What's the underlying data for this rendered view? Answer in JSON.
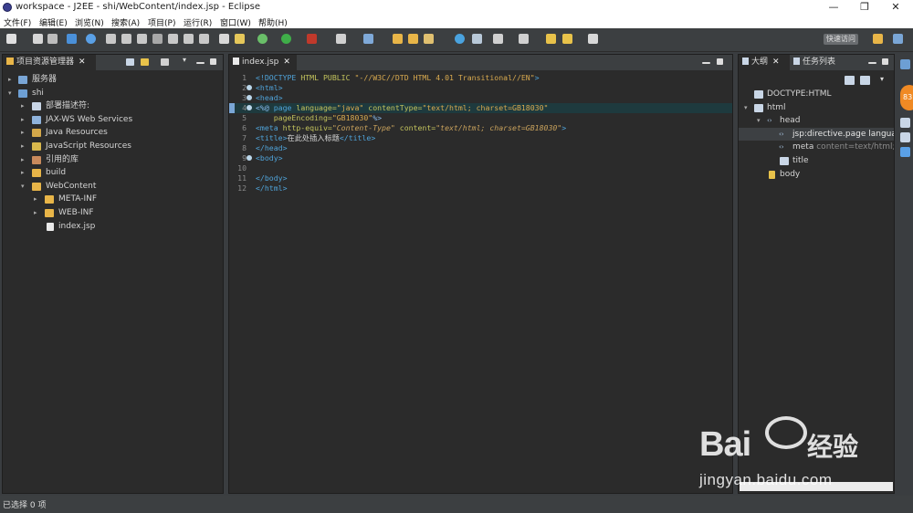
{
  "window": {
    "title": "workspace - J2EE - shi/WebContent/index.jsp - Eclipse",
    "minimize": "—",
    "maximize": "❐",
    "close": "✕"
  },
  "menu": [
    "文件(F)",
    "编辑(E)",
    "浏览(N)",
    "搜索(A)",
    "项目(P)",
    "运行(R)",
    "窗口(W)",
    "帮助(H)"
  ],
  "toolbar": {
    "quick_access": "快速访问"
  },
  "project_explorer": {
    "tab_label": "项目资源管理器",
    "items": [
      {
        "label": "服务器",
        "depth": 0,
        "twisty": "▸",
        "icon": "folder"
      },
      {
        "label": "shi",
        "depth": 0,
        "twisty": "▾",
        "icon": "project"
      },
      {
        "label": "部署描述符:",
        "depth": 1,
        "twisty": "▸",
        "icon": "descriptor"
      },
      {
        "label": "JAX-WS Web Services",
        "depth": 1,
        "twisty": "▸",
        "icon": "ws"
      },
      {
        "label": "Java Resources",
        "depth": 1,
        "twisty": "▸",
        "icon": "java"
      },
      {
        "label": "JavaScript Resources",
        "depth": 1,
        "twisty": "▸",
        "icon": "js"
      },
      {
        "label": "引用的库",
        "depth": 1,
        "twisty": "▸",
        "icon": "folder"
      },
      {
        "label": "build",
        "depth": 1,
        "twisty": "▸",
        "icon": "folder"
      },
      {
        "label": "WebContent",
        "depth": 1,
        "twisty": "▾",
        "icon": "folder"
      },
      {
        "label": "META-INF",
        "depth": 2,
        "twisty": "▸",
        "icon": "folder"
      },
      {
        "label": "WEB-INF",
        "depth": 2,
        "twisty": "▸",
        "icon": "folder"
      },
      {
        "label": "index.jsp",
        "depth": 2,
        "twisty": "",
        "icon": "file"
      }
    ]
  },
  "editor": {
    "tab_label": "index.jsp",
    "lines": [
      {
        "n": "1",
        "text": "<!DOCTYPE HTML PUBLIC \"-//W3C//DTD HTML 4.01 Transitional//EN\">"
      },
      {
        "n": "2",
        "text": "<html>"
      },
      {
        "n": "3",
        "text": "<head>"
      },
      {
        "n": "4",
        "text": "<%@ page language=\"java\" contentType=\"text/html; charset=GB18030\""
      },
      {
        "n": "5",
        "text": "    pageEncoding=\"GB18030\"%>"
      },
      {
        "n": "6",
        "text": "<meta http-equiv=\"Content-Type\" content=\"text/html; charset=GB18030\">"
      },
      {
        "n": "7",
        "text": "<title>在此处插入标题</title>"
      },
      {
        "n": "8",
        "text": "</head>"
      },
      {
        "n": "9",
        "text": "<body>"
      },
      {
        "n": "10",
        "text": ""
      },
      {
        "n": "11",
        "text": "</body>"
      },
      {
        "n": "12",
        "text": "</html>"
      }
    ]
  },
  "outline": {
    "tab_label": "大纲",
    "tab2_label": "任务列表",
    "items": [
      {
        "label": "DOCTYPE:HTML",
        "detail": "",
        "depth": 0,
        "twisty": ""
      },
      {
        "label": "html",
        "detail": "",
        "depth": 0,
        "twisty": "▾"
      },
      {
        "label": "head",
        "detail": "",
        "depth": 1,
        "twisty": "▾"
      },
      {
        "label": "jsp:directive.page languag",
        "detail": "",
        "depth": 2,
        "twisty": ""
      },
      {
        "label": "meta",
        "detail": "content=text/html; c",
        "depth": 2,
        "twisty": ""
      },
      {
        "label": "title",
        "detail": "",
        "depth": 2,
        "twisty": ""
      },
      {
        "label": "body",
        "detail": "",
        "depth": 1,
        "twisty": ""
      }
    ]
  },
  "status": {
    "text": "已选择 0 项"
  },
  "notification_badge": "83",
  "watermark": {
    "brand": "Bai",
    "brand_cn": "经验",
    "url": "jingyan.baidu.com"
  },
  "colors": {
    "editor_bg": "#2b2b2b",
    "highlight_line": "#1e3a3e",
    "tag": "#4fa3d9",
    "attr": "#c4c45d",
    "string": "#d9aa4f"
  }
}
